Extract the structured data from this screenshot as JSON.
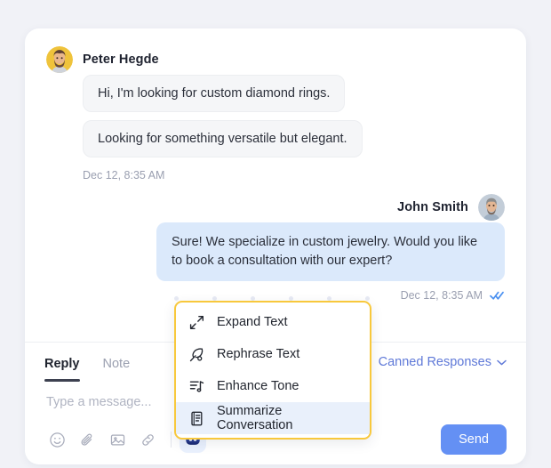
{
  "conversation": {
    "messages": [
      {
        "sender": "Peter Hegde",
        "direction": "incoming",
        "avatar": "peter-avatar",
        "bubbles": [
          "Hi, I'm looking for custom diamond rings.",
          "Looking for something versatile but elegant."
        ],
        "timestamp": "Dec 12, 8:35 AM"
      },
      {
        "sender": "John Smith",
        "direction": "outgoing",
        "avatar": "john-avatar",
        "bubbles": [
          "Sure! We specialize in custom jewelry. Would you like to book a consultation with our expert?"
        ],
        "timestamp": "Dec 12, 8:35 AM",
        "read_status": "read"
      }
    ]
  },
  "composer": {
    "tabs": [
      {
        "label": "Reply",
        "active": true
      },
      {
        "label": "Note",
        "active": false
      }
    ],
    "canned_responses_label": "Canned Responses",
    "input": {
      "value": "",
      "placeholder": "Type a message..."
    },
    "tools": [
      {
        "name": "emoji-icon",
        "label": "Emoji"
      },
      {
        "name": "attachment-icon",
        "label": "Attach file"
      },
      {
        "name": "image-icon",
        "label": "Insert image"
      },
      {
        "name": "link-icon",
        "label": "Insert link"
      }
    ],
    "ai_assist_label": "AI Assist",
    "send_label": "Send"
  },
  "ai_menu": {
    "items": [
      {
        "label": "Expand Text",
        "icon": "expand-arrows-icon",
        "highlighted": false
      },
      {
        "label": "Rephrase Text",
        "icon": "feather-pen-icon",
        "highlighted": false
      },
      {
        "label": "Enhance Tone",
        "icon": "tone-music-icon",
        "highlighted": false
      },
      {
        "label": "Summarize Conversation",
        "icon": "document-icon",
        "highlighted": true
      }
    ]
  },
  "colors": {
    "page_background": "#f1f2f7",
    "card_background": "#ffffff",
    "incoming_bubble": "#f5f6f8",
    "outgoing_bubble": "#dbe9fb",
    "accent_blue": "#6490f4",
    "link_blue": "#5f79d8",
    "menu_border_yellow": "#f8c83c",
    "menu_highlight": "#e9f0fb",
    "active_tab_underline": "#3d4150"
  }
}
